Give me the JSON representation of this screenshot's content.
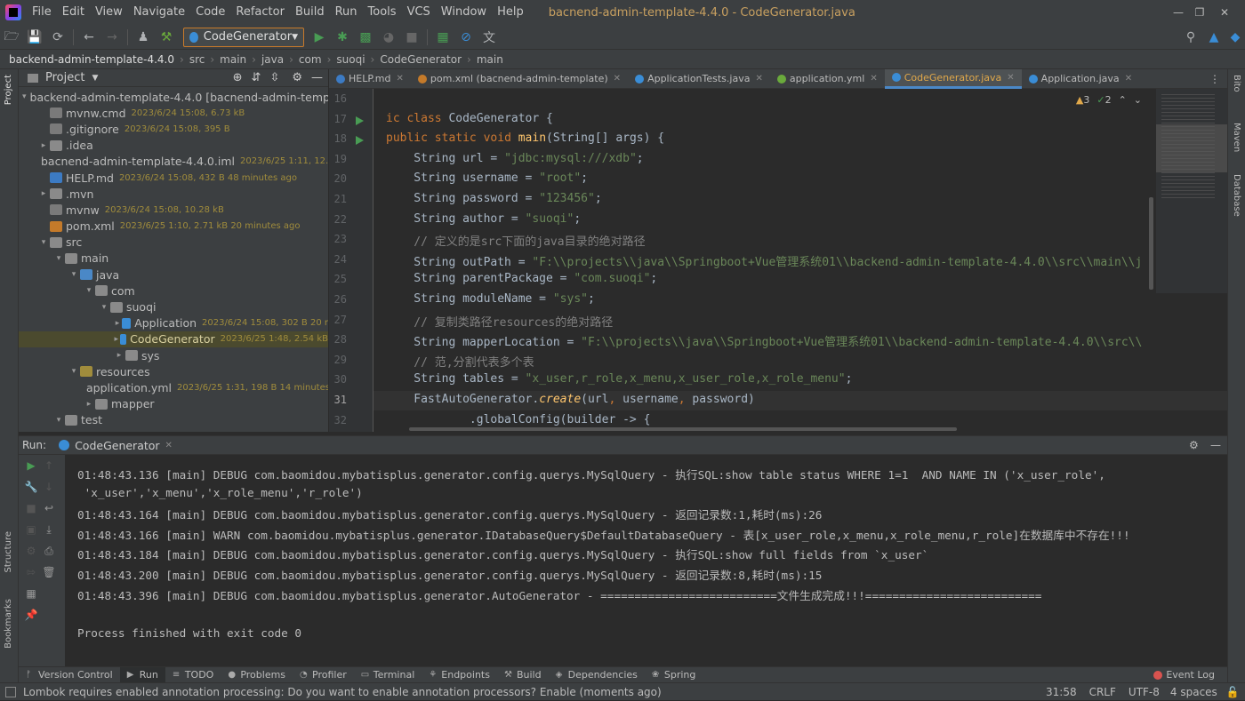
{
  "app": {
    "window_title": "bacnend-admin-template-4.4.0 - CodeGenerator.java",
    "menu": [
      "File",
      "Edit",
      "View",
      "Navigate",
      "Code",
      "Refactor",
      "Build",
      "Run",
      "Tools",
      "VCS",
      "Window",
      "Help"
    ]
  },
  "toolbar": {
    "run_config": "CodeGenerator"
  },
  "breadcrumb": [
    "backend-admin-template-4.4.0",
    "src",
    "main",
    "java",
    "com",
    "suoqi",
    "CodeGenerator",
    "main"
  ],
  "project": {
    "title": "Project",
    "tree": [
      {
        "label": "backend-admin-template-4.4.0 [bacnend-admin-templa",
        "meta": "",
        "indent": 0,
        "arrow": "▾",
        "icon": "folder"
      },
      {
        "label": "mvnw.cmd",
        "meta": "2023/6/24 15:08, 6.73 kB",
        "indent": 1,
        "arrow": "",
        "icon": "file-generic"
      },
      {
        "label": ".gitignore",
        "meta": "2023/6/24 15:08, 395 B",
        "indent": 1,
        "arrow": "",
        "icon": "file-generic"
      },
      {
        "label": ".idea",
        "meta": "",
        "indent": 1,
        "arrow": "▸",
        "icon": "folder"
      },
      {
        "label": "bacnend-admin-template-4.4.0.iml",
        "meta": "2023/6/25 1:11, 12.0",
        "indent": 1,
        "arrow": "",
        "icon": "file-generic"
      },
      {
        "label": "HELP.md",
        "meta": "2023/6/24 15:08, 432 B 48 minutes ago",
        "indent": 1,
        "arrow": "",
        "icon": "file-md"
      },
      {
        "label": ".mvn",
        "meta": "",
        "indent": 1,
        "arrow": "▸",
        "icon": "folder"
      },
      {
        "label": "mvnw",
        "meta": "2023/6/24 15:08, 10.28 kB",
        "indent": 1,
        "arrow": "",
        "icon": "file-generic"
      },
      {
        "label": "pom.xml",
        "meta": "2023/6/25 1:10, 2.71 kB 20 minutes ago",
        "indent": 1,
        "arrow": "",
        "icon": "file-xml"
      },
      {
        "label": "src",
        "meta": "",
        "indent": 1,
        "arrow": "▾",
        "icon": "folder"
      },
      {
        "label": "main",
        "meta": "",
        "indent": 2,
        "arrow": "▾",
        "icon": "folder"
      },
      {
        "label": "java",
        "meta": "",
        "indent": 3,
        "arrow": "▾",
        "icon": "folder-src"
      },
      {
        "label": "com",
        "meta": "",
        "indent": 4,
        "arrow": "▾",
        "icon": "folder"
      },
      {
        "label": "suoqi",
        "meta": "",
        "indent": 5,
        "arrow": "▾",
        "icon": "folder"
      },
      {
        "label": "Application",
        "meta": "2023/6/24 15:08, 302 B 20 r",
        "indent": 6,
        "arrow": "▸",
        "icon": "file-java"
      },
      {
        "label": "CodeGenerator",
        "meta": "2023/6/25 1:48, 2.54 kB",
        "indent": 6,
        "arrow": "▸",
        "icon": "file-java",
        "selected": true
      },
      {
        "label": "sys",
        "meta": "",
        "indent": 6,
        "arrow": "▸",
        "icon": "folder"
      },
      {
        "label": "resources",
        "meta": "",
        "indent": 3,
        "arrow": "▾",
        "icon": "folder-res"
      },
      {
        "label": "application.yml",
        "meta": "2023/6/25 1:31, 198 B 14 minutes",
        "indent": 4,
        "arrow": "",
        "icon": "file-yml"
      },
      {
        "label": "mapper",
        "meta": "",
        "indent": 4,
        "arrow": "▸",
        "icon": "folder"
      },
      {
        "label": "test",
        "meta": "",
        "indent": 2,
        "arrow": "▾",
        "icon": "folder"
      }
    ]
  },
  "editor": {
    "tabs": [
      {
        "label": "HELP.md",
        "color": "#3c7bc4",
        "active": false
      },
      {
        "label": "pom.xml (bacnend-admin-template)",
        "color": "#c47a2a",
        "active": false
      },
      {
        "label": "ApplicationTests.java",
        "color": "#3a8dd6",
        "active": false
      },
      {
        "label": "application.yml",
        "color": "#6aaa3c",
        "active": false
      },
      {
        "label": "CodeGenerator.java",
        "color": "#3a8dd6",
        "active": true
      },
      {
        "label": "Application.java",
        "color": "#3a8dd6",
        "active": false
      }
    ],
    "inspections": {
      "warnings": "3",
      "ok": "2"
    },
    "line_numbers": [
      "16",
      "17",
      "18",
      "19",
      "20",
      "21",
      "22",
      "23",
      "24",
      "25",
      "26",
      "27",
      "28",
      "29",
      "30",
      "31",
      "32"
    ],
    "lines": [
      "",
      "ic class CodeGenerator {",
      "public static void main(String[] args) {",
      "    String url = \"jdbc:mysql:///xdb\";",
      "    String username = \"root\";",
      "    String password = \"123456\";",
      "    String author = \"suoqi\";",
      "    // 定义的是src下面的java目录的绝对路径",
      "    String outPath = \"F:\\\\projects\\\\java\\\\Springboot+Vue管理系统01\\\\backend-admin-template-4.4.0\\\\src\\\\main\\\\j",
      "    String parentPackage = \"com.suoqi\";",
      "    String moduleName = \"sys\";",
      "    // 复制类路径resources的绝对路径",
      "    String mapperLocation = \"F:\\\\projects\\\\java\\\\Springboot+Vue管理系统01\\\\backend-admin-template-4.4.0\\\\src\\\\",
      "    // 范,分割代表多个表",
      "    String tables = \"x_user,r_role,x_menu,x_user_role,x_role_menu\";",
      "    FastAutoGenerator.create(url, username, password)",
      "            .globalConfig(builder -> {"
    ]
  },
  "run": {
    "label": "Run:",
    "tab": "CodeGenerator",
    "console": [
      "01:48:43.136 [main] DEBUG com.baomidou.mybatisplus.generator.config.querys.MySqlQuery - 执行SQL:show table status WHERE 1=1  AND NAME IN ('x_user_role',",
      " 'x_user','x_menu','x_role_menu','r_role')",
      "01:48:43.164 [main] DEBUG com.baomidou.mybatisplus.generator.config.querys.MySqlQuery - 返回记录数:1,耗时(ms):26",
      "01:48:43.166 [main] WARN com.baomidou.mybatisplus.generator.IDatabaseQuery$DefaultDatabaseQuery - 表[x_user_role,x_menu,x_role_menu,r_role]在数据库中不存在!!!",
      "01:48:43.184 [main] DEBUG com.baomidou.mybatisplus.generator.config.querys.MySqlQuery - 执行SQL:show full fields from `x_user`",
      "01:48:43.200 [main] DEBUG com.baomidou.mybatisplus.generator.config.querys.MySqlQuery - 返回记录数:8,耗时(ms):15",
      "01:48:43.396 [main] DEBUG com.baomidou.mybatisplus.generator.AutoGenerator - ==========================文件生成完成!!!==========================",
      "",
      "Process finished with exit code 0"
    ]
  },
  "bottom_tools": [
    {
      "label": "Version Control",
      "icon": "ᚠ"
    },
    {
      "label": "Run",
      "icon": "▶",
      "active": true
    },
    {
      "label": "TODO",
      "icon": "≡"
    },
    {
      "label": "Problems",
      "icon": "●"
    },
    {
      "label": "Profiler",
      "icon": "◔"
    },
    {
      "label": "Terminal",
      "icon": "▭"
    },
    {
      "label": "Endpoints",
      "icon": "⚘"
    },
    {
      "label": "Build",
      "icon": "⚒"
    },
    {
      "label": "Dependencies",
      "icon": "◈"
    },
    {
      "label": "Spring",
      "icon": "❀"
    }
  ],
  "event_log": "Event Log",
  "status": {
    "message": "Lombok requires enabled annotation processing: Do you want to enable annotation processors? Enable (moments ago)",
    "position": "31:58",
    "line_sep": "CRLF",
    "encoding": "UTF-8",
    "indent": "4 spaces"
  },
  "side_labels": {
    "project": "Project",
    "structure": "Structure",
    "bookmarks": "Bookmarks",
    "bito": "Bito",
    "maven": "Maven",
    "database": "Database"
  }
}
